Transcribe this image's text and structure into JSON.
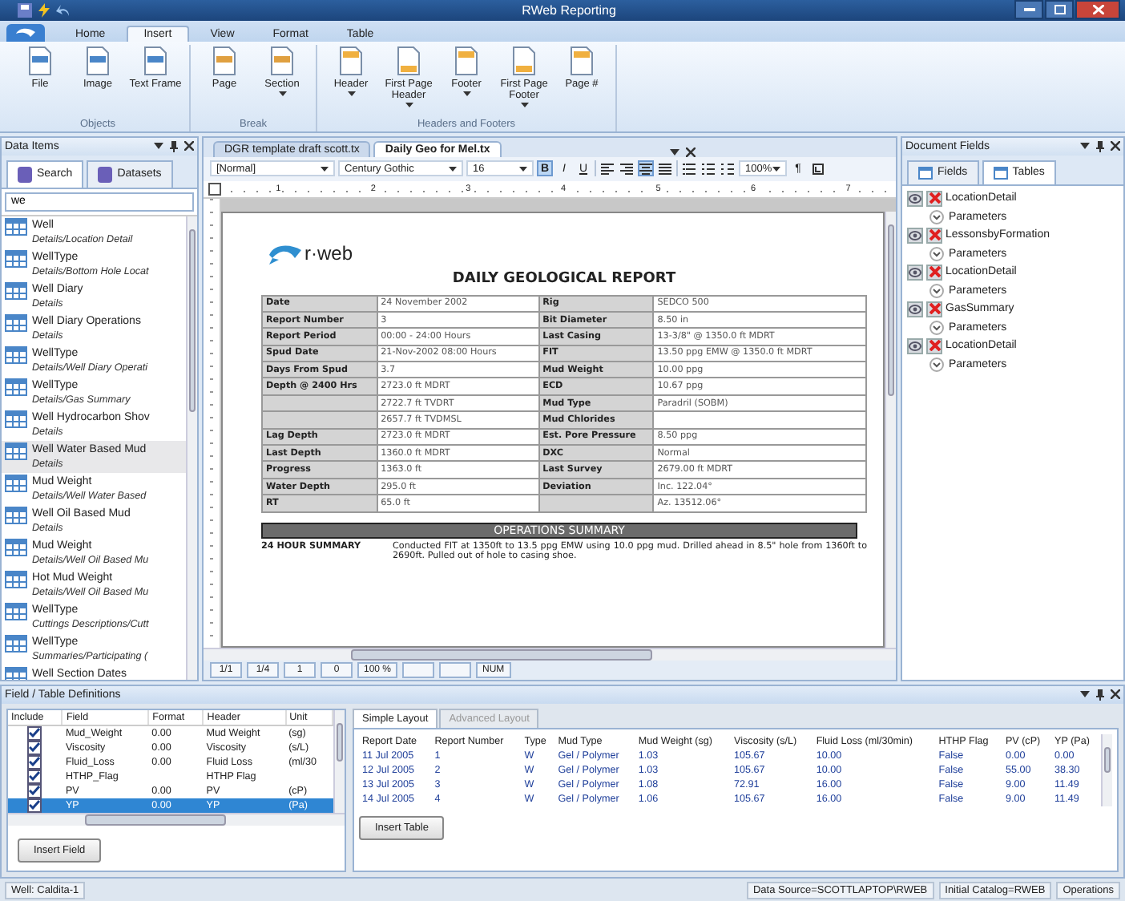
{
  "window": {
    "title": "RWeb Reporting"
  },
  "ribbon": {
    "tabs": [
      {
        "label": "Home",
        "selected": false
      },
      {
        "label": "Insert",
        "selected": true
      },
      {
        "label": "View",
        "selected": false
      },
      {
        "label": "Format",
        "selected": false
      },
      {
        "label": "Table",
        "selected": false
      }
    ],
    "groups": [
      {
        "label": "Objects",
        "buttons": [
          {
            "label": "File",
            "dropdown": false
          },
          {
            "label": "Image",
            "dropdown": false
          },
          {
            "label": "Text Frame",
            "dropdown": false
          }
        ]
      },
      {
        "label": "Break",
        "buttons": [
          {
            "label": "Page",
            "dropdown": false
          },
          {
            "label": "Section",
            "dropdown": true
          }
        ]
      },
      {
        "label": "Headers and Footers",
        "buttons": [
          {
            "label": "Header",
            "dropdown": true
          },
          {
            "label": "First Page Header",
            "dropdown": true
          },
          {
            "label": "Footer",
            "dropdown": true
          },
          {
            "label": "First Page Footer",
            "dropdown": true
          },
          {
            "label": "Page #",
            "dropdown": false
          }
        ]
      }
    ]
  },
  "data_items": {
    "title": "Data Items",
    "tabs": [
      {
        "label": "Search",
        "selected": true
      },
      {
        "label": "Datasets",
        "selected": false
      }
    ],
    "search": {
      "value": "we"
    },
    "items": [
      {
        "name": "Well",
        "path": "Details/Location Detail",
        "selected": false
      },
      {
        "name": "WellType",
        "path": "Details/Bottom Hole Locat",
        "selected": false
      },
      {
        "name": "Well Diary",
        "path": "Details",
        "selected": false
      },
      {
        "name": "Well Diary Operations",
        "path": "Details",
        "selected": false
      },
      {
        "name": "WellType",
        "path": "Details/Well Diary Operati",
        "selected": false
      },
      {
        "name": "WellType",
        "path": "Details/Gas Summary",
        "selected": false
      },
      {
        "name": "Well Hydrocarbon Shov",
        "path": "Details",
        "selected": false
      },
      {
        "name": "Well Water Based Mud",
        "path": "Details",
        "selected": true
      },
      {
        "name": "Mud Weight",
        "path": "Details/Well Water Based",
        "selected": false
      },
      {
        "name": "Well Oil Based Mud",
        "path": "Details",
        "selected": false
      },
      {
        "name": "Mud Weight",
        "path": "Details/Well Oil Based Mu",
        "selected": false
      },
      {
        "name": "Hot Mud Weight",
        "path": "Details/Well Oil Based Mu",
        "selected": false
      },
      {
        "name": "WellType",
        "path": "Cuttings Descriptions/Cutt",
        "selected": false
      },
      {
        "name": "WellType",
        "path": "Summaries/Participating (",
        "selected": false
      },
      {
        "name": "Well Section Dates",
        "selected": false
      }
    ]
  },
  "document": {
    "tabs": [
      {
        "label": "DGR template draft scott.tx",
        "selected": false
      },
      {
        "label": "Daily Geo for Mel.tx",
        "selected": true
      }
    ],
    "toolbar": {
      "style": "[Normal]",
      "font": "Century Gothic",
      "size": "16",
      "format_buttons": [
        {
          "label": "B",
          "selected": true
        },
        {
          "label": "I",
          "selected": false
        },
        {
          "label": "U",
          "selected": false
        }
      ],
      "align_buttons": [
        {
          "selected": false
        },
        {
          "selected": false
        },
        {
          "selected": true
        },
        {
          "selected": false
        }
      ],
      "zoom": "100%",
      "pilcrow": "¶"
    },
    "ruler_marks": [
      "1",
      "2",
      "3",
      "4",
      "5",
      "6",
      "7"
    ],
    "report": {
      "logo": "r·web",
      "title": "DAILY GEOLOGICAL REPORT",
      "rows": [
        {
          "label1": "Date",
          "value1": "24 November 2002",
          "label2": "Rig",
          "value2": "SEDCO 500"
        },
        {
          "label1": "Report Number",
          "value1": "3",
          "label2": "Bit Diameter",
          "value2": "8.50 in"
        },
        {
          "label1": "Report Period",
          "value1": "00:00 - 24:00 Hours",
          "label2": "Last Casing",
          "value2": "13-3/8\" @ 1350.0 ft MDRT"
        },
        {
          "label1": "Spud Date",
          "value1": "21-Nov-2002 08:00 Hours",
          "label2": "FIT",
          "value2": "13.50 ppg EMW @ 1350.0 ft MDRT"
        },
        {
          "label1": "Days From Spud",
          "value1": "3.7",
          "label2": "Mud Weight",
          "value2": "10.00 ppg"
        },
        {
          "label1": "Depth @ 2400 Hrs",
          "value1": "2723.0 ft MDRT",
          "label2": "ECD",
          "value2": "10.67 ppg"
        },
        {
          "value1": "2722.7 ft TVDRT",
          "label2": "Mud Type",
          "value2": "Paradril (SOBM)"
        },
        {
          "value1": "2657.7 ft TVDMSL",
          "label2": "Mud Chlorides"
        },
        {
          "label1": "Lag Depth",
          "value1": "2723.0 ft MDRT",
          "label2": "Est. Pore Pressure",
          "value2": "8.50 ppg"
        },
        {
          "label1": "Last Depth",
          "value1": "1360.0 ft MDRT",
          "label2": "DXC",
          "value2": "Normal"
        },
        {
          "label1": "Progress",
          "value1": "1363.0 ft",
          "label2": "Last Survey",
          "value2": "2679.00 ft MDRT"
        },
        {
          "label1": "Water Depth",
          "value1": "295.0 ft",
          "label2": "Deviation",
          "value2": "Inc. 122.04°"
        },
        {
          "label1": "RT",
          "value1": "65.0 ft",
          "value2": "Az. 13512.06°"
        }
      ],
      "section": "OPERATIONS SUMMARY",
      "summary_label": "24 HOUR SUMMARY",
      "summary_text": "Conducted FIT at 1350ft to 13.5 ppg EMW using 10.0 ppg mud. Drilled ahead in 8.5\" hole from 1360ft to 2690ft. Pulled out of hole to casing shoe."
    },
    "status": [
      "1/1",
      "1/4",
      "1",
      "0",
      "100 %",
      "NUM"
    ]
  },
  "document_fields": {
    "title": "Document Fields",
    "tabs": [
      {
        "label": "Fields",
        "selected": false
      },
      {
        "label": "Tables",
        "selected": true
      }
    ],
    "tables": [
      {
        "name": "LocationDetail",
        "child": "Parameters"
      },
      {
        "name": "LessonsbyFormation",
        "child": "Parameters"
      },
      {
        "name": "LocationDetail",
        "child": "Parameters"
      },
      {
        "name": "GasSummary",
        "child": "Parameters"
      },
      {
        "name": "LocationDetail",
        "child": "Parameters"
      }
    ]
  },
  "definitions": {
    "title": "Field / Table Definitions",
    "columns": [
      "Include",
      "Field",
      "Format",
      "Header",
      "Unit"
    ],
    "rows": [
      {
        "checked": true,
        "field": "Mud_Weight",
        "format": "0.00",
        "header": "Mud Weight",
        "unit": "(sg)",
        "selected": false
      },
      {
        "checked": true,
        "field": "Viscosity",
        "format": "0.00",
        "header": "Viscosity",
        "unit": "(s/L)",
        "selected": false
      },
      {
        "checked": true,
        "field": "Fluid_Loss",
        "format": "0.00",
        "header": "Fluid Loss",
        "unit": "(ml/30",
        "selected": false
      },
      {
        "checked": true,
        "field": "HTHP_Flag",
        "header": "HTHP Flag",
        "selected": false
      },
      {
        "checked": true,
        "field": "PV",
        "format": "0.00",
        "header": "PV",
        "unit": "(cP)",
        "selected": false
      },
      {
        "checked": true,
        "field": "YP",
        "format": "0.00",
        "header": "YP",
        "unit": "(Pa)",
        "selected": true
      }
    ],
    "insert_field": "Insert Field",
    "layout_tabs": [
      {
        "label": "Simple Layout",
        "selected": true
      },
      {
        "label": "Advanced Layout",
        "selected": false
      }
    ],
    "preview_columns": [
      "Report Date",
      "Report Number",
      "Type",
      "Mud Type",
      "Mud Weight (sg)",
      "Viscosity (s/L)",
      "Fluid Loss (ml/30min)",
      "HTHP Flag",
      "PV (cP)",
      "YP (Pa)"
    ],
    "preview_rows": [
      [
        "11 Jul 2005",
        "1",
        "W",
        "Gel / Polymer",
        "1.03",
        "105.67",
        "10.00",
        "False",
        "0.00",
        "0.00"
      ],
      [
        "12 Jul 2005",
        "2",
        "W",
        "Gel / Polymer",
        "1.03",
        "105.67",
        "10.00",
        "False",
        "55.00",
        "38.30"
      ],
      [
        "13 Jul 2005",
        "3",
        "W",
        "Gel / Polymer",
        "1.08",
        "72.91",
        "16.00",
        "False",
        "9.00",
        "11.49"
      ],
      [
        "14 Jul 2005",
        "4",
        "W",
        "Gel / Polymer",
        "1.06",
        "105.67",
        "16.00",
        "False",
        "9.00",
        "11.49"
      ]
    ],
    "insert_table": "Insert Table"
  },
  "status_bar": {
    "well": "Well: Caldita-1",
    "data_source": "Data Source=SCOTTLAPTOP\\RWEB",
    "catalog": "Initial Catalog=RWEB",
    "mode": "Operations"
  }
}
